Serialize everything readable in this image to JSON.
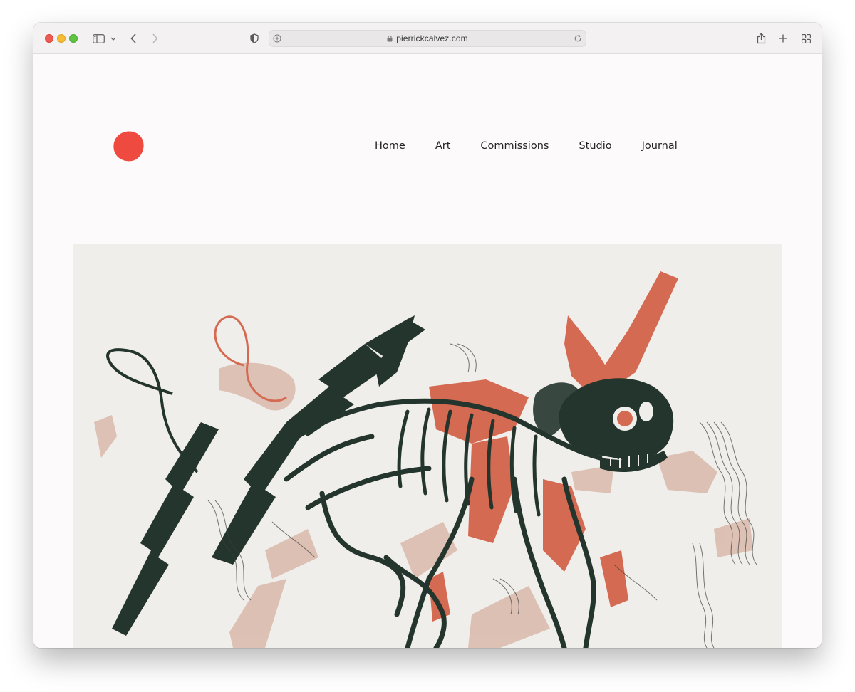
{
  "browser": {
    "url": "pierrickcalvez.com"
  },
  "nav": {
    "items": [
      {
        "label": "Home",
        "active": true
      },
      {
        "label": "Art",
        "active": false
      },
      {
        "label": "Commissions",
        "active": false
      },
      {
        "label": "Studio",
        "active": false
      },
      {
        "label": "Journal",
        "active": false
      }
    ]
  },
  "colors": {
    "logo": "#ef4a3f",
    "accent": "#d56a52",
    "ink": "#23352d",
    "blush": "#d8b5a8"
  },
  "icons": [
    "sidebar-icon",
    "chevron-down-icon",
    "back-icon",
    "forward-icon",
    "shield-icon",
    "plus-circle-icon",
    "lock-icon",
    "reload-icon",
    "share-icon",
    "new-tab-icon",
    "tab-overview-icon"
  ]
}
